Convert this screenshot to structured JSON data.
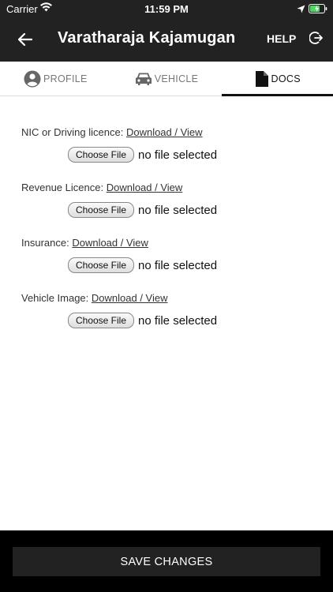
{
  "status_bar": {
    "carrier": "Carrier",
    "time": "11:59 PM"
  },
  "app_bar": {
    "title": "Varatharaja Kajamugan",
    "help_label": "HELP"
  },
  "tabs": [
    {
      "label": "PROFILE",
      "icon": "user-circle-icon"
    },
    {
      "label": "VEHICLE",
      "icon": "car-icon"
    },
    {
      "label": "DOCS",
      "icon": "document-icon"
    }
  ],
  "documents": [
    {
      "label": "NIC or Driving licence:",
      "link": "Download / View",
      "button": "Choose File",
      "status": "no file selected"
    },
    {
      "label": "Revenue Licence:",
      "link": "Download / View",
      "button": "Choose File",
      "status": "no file selected"
    },
    {
      "label": "Insurance:",
      "link": "Download / View",
      "button": "Choose File",
      "status": "no file selected"
    },
    {
      "label": "Vehicle Image:",
      "link": "Download / View",
      "button": "Choose File",
      "status": "no file selected"
    }
  ],
  "footer": {
    "save_label": "SAVE CHANGES"
  },
  "colors": {
    "header_bg": "#222222",
    "footer_bg": "#000000",
    "active_tab": "#111111"
  }
}
